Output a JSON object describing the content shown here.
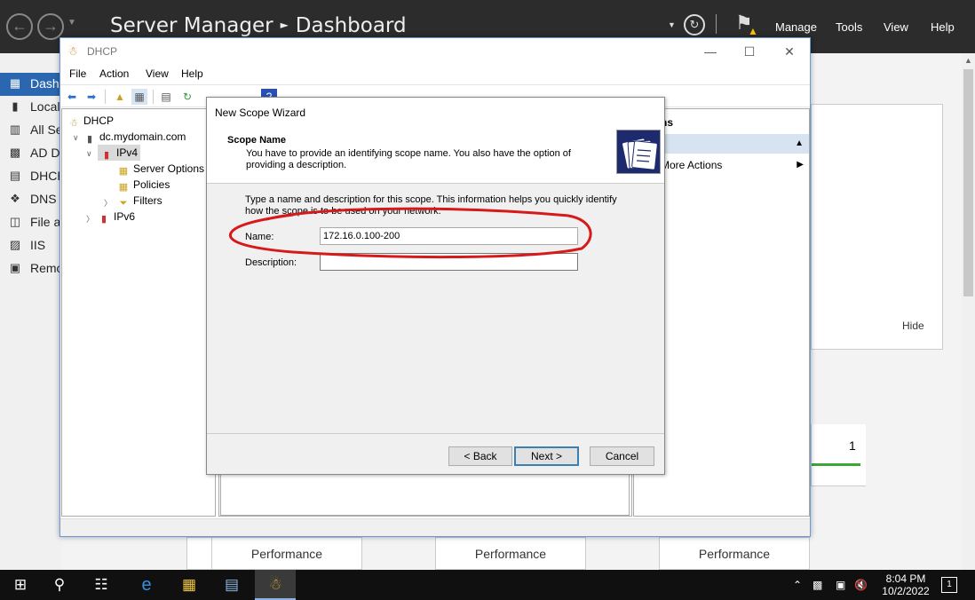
{
  "server_manager": {
    "title": "Server Manager",
    "breadcrumb": "Dashboard",
    "menu": [
      "Manage",
      "Tools",
      "View",
      "Help"
    ],
    "sidebar": [
      {
        "label": "Dashb",
        "icon": "dashboard-icon"
      },
      {
        "label": "Local",
        "icon": "server-icon"
      },
      {
        "label": "All Se",
        "icon": "servers-icon"
      },
      {
        "label": "AD D",
        "icon": "ad-icon"
      },
      {
        "label": "DHCP",
        "icon": "dhcp-icon"
      },
      {
        "label": "DNS",
        "icon": "dns-icon"
      },
      {
        "label": "File a",
        "icon": "file-icon"
      },
      {
        "label": "IIS",
        "icon": "iis-icon"
      },
      {
        "label": "Remo",
        "icon": "remote-icon"
      }
    ],
    "hide_label": "Hide",
    "count": "1",
    "performance": [
      "Performance",
      "Performance",
      "Performance"
    ]
  },
  "dhcp_window": {
    "title": "DHCP",
    "menu": [
      "File",
      "Action",
      "View",
      "Help"
    ],
    "tree": {
      "root": "DHCP",
      "server": "dc.mydomain.com",
      "ipv4": "IPv4",
      "server_options": "Server Options",
      "policies": "Policies",
      "filters": "Filters",
      "ipv6": "IPv6"
    },
    "actions": {
      "header": "ns",
      "more": "More Actions"
    }
  },
  "wizard": {
    "title": "New Scope Wizard",
    "header_title": "Scope Name",
    "header_sub": "You have to provide an identifying scope name. You also have the option of providing a description.",
    "body_text": "Type a name and description for this scope. This information helps you quickly identify how the scope is to be used on your network.",
    "name_label": "Name:",
    "name_value": "172.16.0.100-200",
    "description_label": "Description:",
    "description_value": "",
    "back_label": "< Back",
    "next_label": "Next >",
    "cancel_label": "Cancel"
  },
  "taskbar": {
    "time": "8:04 PM",
    "date": "10/2/2022",
    "notification_count": "1"
  },
  "colors": {
    "annotation": "#d61a1a",
    "sm_titlebar": "#2c2c2c",
    "selected_sidebar": "#2a67b0"
  }
}
